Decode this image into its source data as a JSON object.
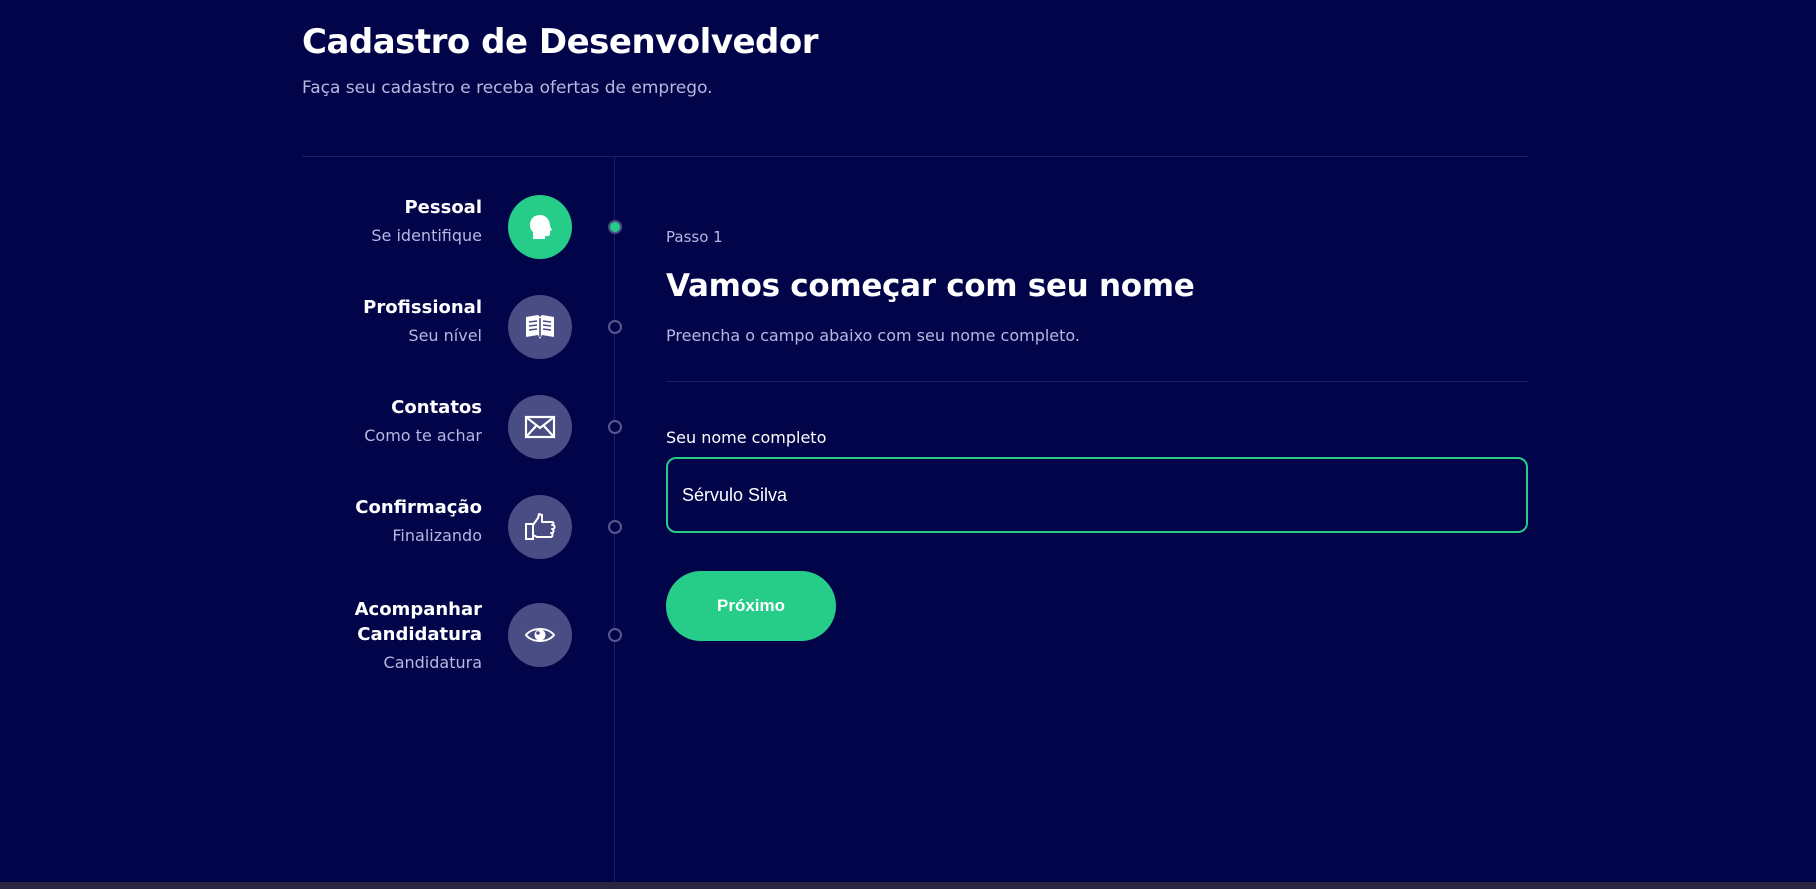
{
  "header": {
    "title": "Cadastro de Desenvolvedor",
    "subtitle": "Faça seu cadastro e receba ofertas de emprego."
  },
  "steps": [
    {
      "title": "Pessoal",
      "subtitle": "Se identifique",
      "icon": "person-head-icon",
      "active": true
    },
    {
      "title": "Profissional",
      "subtitle": "Seu nível",
      "icon": "book-icon",
      "active": false
    },
    {
      "title": "Contatos",
      "subtitle": "Como te achar",
      "icon": "envelope-icon",
      "active": false
    },
    {
      "title": "Confirmação",
      "subtitle": "Finalizando",
      "icon": "thumbs-up-icon",
      "active": false
    },
    {
      "title": "Acompanhar Candidatura",
      "subtitle": "Candidatura",
      "icon": "eye-icon",
      "active": false
    }
  ],
  "main": {
    "step_label": "Passo 1",
    "title": "Vamos começar com seu nome",
    "description": "Preencha o campo abaixo com seu nome completo.",
    "field_label": "Seu nome completo",
    "field_value": "Sérvulo Silva",
    "next_label": "Próximo"
  },
  "colors": {
    "background": "#02044a",
    "accent": "#25cd89",
    "inactive_icon": "#4a4c84",
    "muted_text": "#b6b8e0"
  }
}
